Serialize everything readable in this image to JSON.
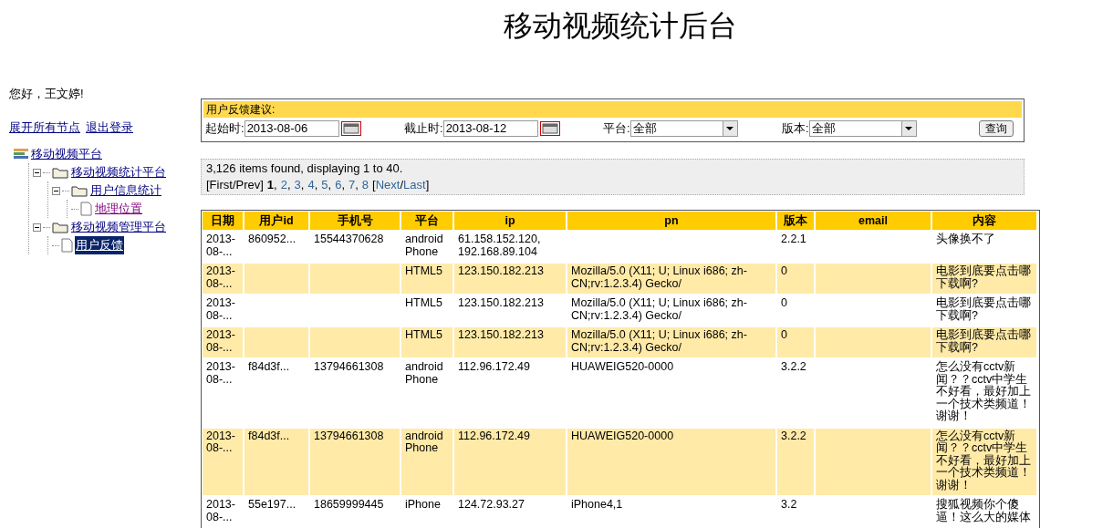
{
  "header": {
    "title": "移动视频统计后台"
  },
  "sidebar": {
    "greeting": "您好，王文婷!",
    "links": [
      "展开所有节点",
      "退出登录"
    ],
    "tree": [
      {
        "label": "移动视频平台",
        "kind": "root",
        "selected": false,
        "visited": false,
        "children": [
          {
            "label": "移动视频统计平台",
            "kind": "folder",
            "selected": false,
            "visited": false,
            "expanded": true,
            "children": [
              {
                "label": "用户信息统计",
                "kind": "folder",
                "selected": false,
                "visited": false,
                "expanded": true,
                "children": [
                  {
                    "label": "地理位置",
                    "kind": "page",
                    "selected": false,
                    "visited": true
                  }
                ]
              }
            ]
          },
          {
            "label": "移动视频管理平台",
            "kind": "folder",
            "selected": false,
            "visited": false,
            "expanded": true,
            "children": [
              {
                "label": "用户反馈",
                "kind": "page",
                "selected": true,
                "visited": false
              }
            ]
          }
        ]
      }
    ]
  },
  "filter": {
    "title": "用户反馈建议:",
    "fields": [
      {
        "label": "起始时:",
        "value": "2013-08-06",
        "kind": "date"
      },
      {
        "label": "截止时:",
        "value": "2013-08-12",
        "kind": "date"
      },
      {
        "label": "平台:",
        "value": "全部",
        "kind": "select"
      },
      {
        "label": "版本:",
        "value": "全部",
        "kind": "select"
      }
    ],
    "button": "查询"
  },
  "pager": {
    "summary": "3,126 items found, displaying 1 to 40.",
    "first_prev": "[First/Prev]",
    "pages": [
      {
        "label": "1",
        "selected": true
      },
      {
        "label": "2",
        "selected": false
      },
      {
        "label": "3",
        "selected": false
      },
      {
        "label": "4",
        "selected": false
      },
      {
        "label": "5",
        "selected": false
      },
      {
        "label": "6",
        "selected": false
      },
      {
        "label": "7",
        "selected": false
      },
      {
        "label": "8",
        "selected": false
      }
    ],
    "separator": ",",
    "open_bracket": "[",
    "next": "Next",
    "slash": "/",
    "last": "Last",
    "close_bracket": "]"
  },
  "table": {
    "columns": [
      "日期",
      "用户id",
      "手机号",
      "平台",
      "ip",
      "pn",
      "版本",
      "email",
      "内容"
    ],
    "rows": [
      [
        "2013-08-...",
        "860952...",
        "15544370628",
        "android Phone",
        "61.158.152.120, 192.168.89.104",
        "",
        "2.2.1",
        "",
        "头像换不了"
      ],
      [
        "2013-08-...",
        "",
        "",
        "HTML5",
        "123.150.182.213",
        "Mozilla/5.0 (X11; U; Linux i686; zh-CN;rv:1.2.3.4) Gecko/",
        "0",
        "",
        "电影到底要点击哪下载啊?"
      ],
      [
        "2013-08-...",
        "",
        "",
        "HTML5",
        "123.150.182.213",
        "Mozilla/5.0 (X11; U; Linux i686; zh-CN;rv:1.2.3.4) Gecko/",
        "0",
        "",
        "电影到底要点击哪下载啊?"
      ],
      [
        "2013-08-...",
        "",
        "",
        "HTML5",
        "123.150.182.213",
        "Mozilla/5.0 (X11; U; Linux i686; zh-CN;rv:1.2.3.4) Gecko/",
        "0",
        "",
        "电影到底要点击哪下载啊?"
      ],
      [
        "2013-08-...",
        "f84d3f...",
        "13794661308",
        "android Phone",
        "112.96.172.49",
        "HUAWEIG520-0000",
        "3.2.2",
        "",
        "怎么没有cctv新闻？？cctv中学生不好看，最好加上一个技术类频道！谢谢！"
      ],
      [
        "2013-08-...",
        "f84d3f...",
        "13794661308",
        "android Phone",
        "112.96.172.49",
        "HUAWEIG520-0000",
        "3.2.2",
        "",
        "怎么没有cctv新闻？？cctv中学生不好看，最好加上一个技术类频道！谢谢！"
      ],
      [
        "2013-08-...",
        "55e197...",
        "18659999445",
        "iPhone",
        "124.72.93.27",
        "iPhone4,1",
        "3.2",
        "",
        "搜狐视频你个傻逼！这么大的媒体"
      ]
    ]
  }
}
